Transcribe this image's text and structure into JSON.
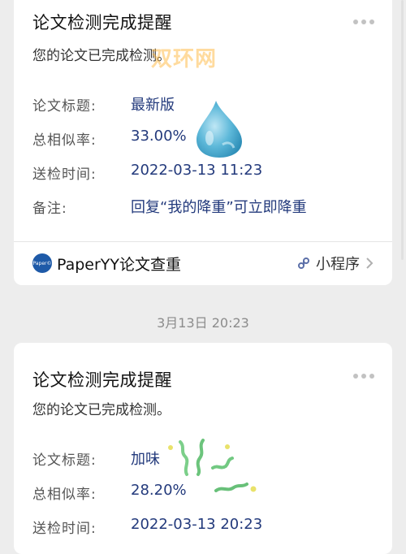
{
  "messages": [
    {
      "title": "论文检测完成提醒",
      "subtitle": "您的论文已完成检测。",
      "fields": [
        {
          "label": "论文标题:",
          "value": "最新版"
        },
        {
          "label": "总相似率:",
          "value": "33.00%"
        },
        {
          "label": "送检时间:",
          "value": "2022-03-13 11:23"
        },
        {
          "label": "备注:",
          "value": "回复“我的降重”可立即降重"
        }
      ],
      "footer": {
        "logo_text": "Paper©",
        "app_name": "PaperYY论文查重",
        "mini_program_label": "小程序"
      }
    },
    {
      "title": "论文检测完成提醒",
      "subtitle": "您的论文已完成检测。",
      "fields": [
        {
          "label": "论文标题:",
          "value": "加味"
        },
        {
          "label": "总相似率:",
          "value": "28.20%"
        },
        {
          "label": "送检时间:",
          "value": "2022-03-13 20:23"
        }
      ]
    }
  ],
  "timestamp": "3月13日 20:23",
  "watermark": "双环网",
  "icons": {
    "more": "more-dots-icon",
    "link": "mini-program-link-icon",
    "chevron": "chevron-right-icon"
  },
  "colors": {
    "background": "#ededed",
    "card": "#ffffff",
    "value_text": "#233a7c",
    "logo": "#1e5aa8",
    "watermark": "#ffaf28"
  }
}
